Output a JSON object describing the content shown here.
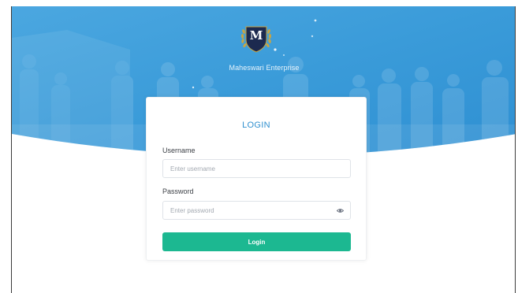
{
  "brand": {
    "logo_letter": "M",
    "name": "Maheswari Enterprise"
  },
  "login": {
    "title": "LOGIN",
    "username_label": "Username",
    "username_placeholder": "Enter username",
    "username_value": "",
    "password_label": "Password",
    "password_placeholder": "Enter password",
    "password_value": "",
    "password_toggle_icon": "eye-icon",
    "submit_label": "Login"
  },
  "colors": {
    "hero_blue": "#3a9bd9",
    "title_blue": "#2f8fcf",
    "button_green": "#1cb891",
    "logo_navy": "#1c2a4f",
    "laurel_gold": "#c9a542"
  }
}
